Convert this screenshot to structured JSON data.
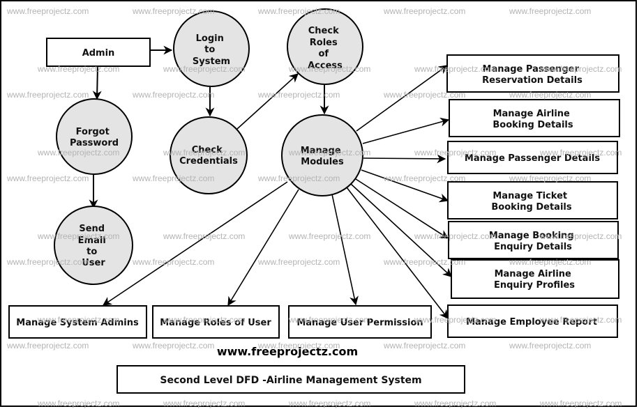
{
  "diagram": {
    "title": "Second Level DFD -Airline Management System",
    "site_label": "www.freeprojectz.com",
    "watermark": "www.freeprojectz.com",
    "colors": {
      "process_fill": "#e4e4e4",
      "stroke": "#000000",
      "watermark": "#b4b4b4"
    },
    "entities": {
      "admin": "Admin"
    },
    "processes": {
      "login": [
        "Login",
        "to",
        "System"
      ],
      "check_roles": [
        "Check",
        "Roles",
        "of",
        "Access"
      ],
      "forgot_password": [
        "Forgot",
        "Password"
      ],
      "check_credentials": [
        "Check",
        "Credentials"
      ],
      "manage_modules": [
        "Manage",
        "Modules"
      ],
      "send_email": [
        "Send",
        "Email",
        "to",
        "User"
      ]
    },
    "outputs": {
      "passenger_reservation": [
        "Manage Passenger",
        "Reservation Details"
      ],
      "airline_booking": [
        "Manage Airline",
        "Booking Details"
      ],
      "passenger_details": [
        "Manage Passenger Details"
      ],
      "ticket_booking": [
        "Manage Ticket",
        "Booking Details"
      ],
      "booking_enquiry": [
        "Manage Booking",
        "Enquiry Details"
      ],
      "airline_enquiry": [
        "Manage Airline",
        "Enquiry Profiles"
      ],
      "employee_report": [
        "Manage Employee  Report"
      ],
      "system_admins": [
        "Manage System Admins"
      ],
      "roles_of_user": [
        "Manage Roles of User"
      ],
      "user_permission": [
        "Manage User Permission"
      ]
    },
    "flows": [
      {
        "from": "Admin",
        "to": "Login to System"
      },
      {
        "from": "Admin",
        "to": "Forgot Password"
      },
      {
        "from": "Login to System",
        "to": "Check Credentials"
      },
      {
        "from": "Check Credentials",
        "to": "Check Roles of Access"
      },
      {
        "from": "Check Roles of Access",
        "to": "Manage Modules"
      },
      {
        "from": "Forgot Password",
        "to": "Send Email to User"
      },
      {
        "from": "Manage Modules",
        "to": "Manage Passenger Reservation Details"
      },
      {
        "from": "Manage Modules",
        "to": "Manage Airline Booking Details"
      },
      {
        "from": "Manage Modules",
        "to": "Manage Passenger Details"
      },
      {
        "from": "Manage Modules",
        "to": "Manage Ticket Booking Details"
      },
      {
        "from": "Manage Modules",
        "to": "Manage Booking Enquiry Details"
      },
      {
        "from": "Manage Modules",
        "to": "Manage Airline Enquiry Profiles"
      },
      {
        "from": "Manage Modules",
        "to": "Manage Employee Report"
      },
      {
        "from": "Manage Modules",
        "to": "Manage System Admins"
      },
      {
        "from": "Manage Modules",
        "to": "Manage Roles of User"
      },
      {
        "from": "Manage Modules",
        "to": "Manage User Permission"
      }
    ]
  }
}
